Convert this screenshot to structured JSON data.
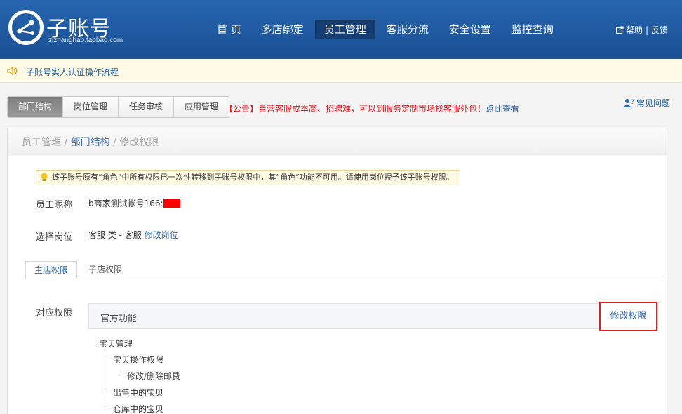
{
  "header": {
    "logo_title": "子账号",
    "logo_subtitle": "zizhanghao.taobao.com",
    "nav": [
      {
        "label": "首 页",
        "active": false
      },
      {
        "label": "多店绑定",
        "active": false
      },
      {
        "label": "员工管理",
        "active": true
      },
      {
        "label": "客服分流",
        "active": false
      },
      {
        "label": "安全设置",
        "active": false
      },
      {
        "label": "监控查询",
        "active": false
      }
    ],
    "help_label": "帮助",
    "separator": "|",
    "feedback_label": "反馈"
  },
  "notice": {
    "text": "子账号实人认证操作流程"
  },
  "tabs": [
    {
      "label": "部门结构",
      "active": true
    },
    {
      "label": "岗位管理",
      "active": false
    },
    {
      "label": "任务审核",
      "active": false
    },
    {
      "label": "应用管理",
      "active": false
    }
  ],
  "announcement": {
    "prefix": "【公告】自营客服成本高、招聘难，可以到服务定制市场找客服外包！",
    "link": "点此查看"
  },
  "faq_label": "常见问题",
  "breadcrumb": {
    "root": "员工管理",
    "sep1": " / ",
    "middle": "部门结构",
    "sep2": " / ",
    "current": "修改权限"
  },
  "tip": "该子账号原有“角色”中所有权限已一次性转移到子账号权限中，其“角色”功能不可用。请使用岗位授予该子账号权限。",
  "employee": {
    "nickname_label": "员工昵称",
    "nickname_value": "b商家测试帐号166:",
    "position_label": "选择岗位",
    "position_value": "客服 类 - 客服",
    "modify_position": "修改岗位"
  },
  "subtabs": [
    {
      "label": "主店权限",
      "active": true
    },
    {
      "label": "子店权限",
      "active": false
    }
  ],
  "permissions": {
    "label": "对应权限",
    "box_title": "官方功能",
    "edit_button": "修改权限",
    "tree": {
      "root": "宝贝管理",
      "child1": "宝贝操作权限",
      "child1_sub": "修改/删除邮费",
      "child2": "出售中的宝贝",
      "child3": "仓库中的宝贝"
    }
  },
  "colors": {
    "header_bg": "#1f5aa0",
    "link": "#2f6cb7",
    "announce_red": "#e4141b",
    "highlight_border": "#e02020"
  }
}
